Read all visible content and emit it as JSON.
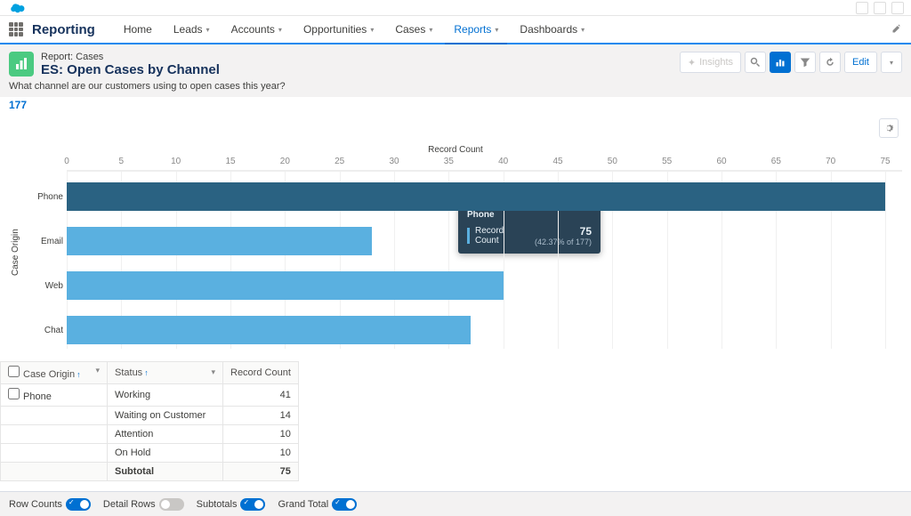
{
  "app": {
    "name": "Reporting"
  },
  "nav": {
    "items": [
      {
        "label": "Home",
        "chev": false
      },
      {
        "label": "Leads",
        "chev": true
      },
      {
        "label": "Accounts",
        "chev": true
      },
      {
        "label": "Opportunities",
        "chev": true
      },
      {
        "label": "Cases",
        "chev": true
      },
      {
        "label": "Reports",
        "chev": true,
        "active": true
      },
      {
        "label": "Dashboards",
        "chev": true
      }
    ]
  },
  "header": {
    "crumb": "Report: Cases",
    "title": "ES: Open Cases by Channel",
    "subtitle": "What channel are our customers using to open cases this year?",
    "total_label": "177",
    "actions": {
      "insights": "Insights",
      "edit": "Edit"
    }
  },
  "chart_data": {
    "type": "bar",
    "orientation": "horizontal",
    "title": "Record Count",
    "ylabel": "Case Origin",
    "xlim": [
      0,
      75
    ],
    "xticks": [
      0,
      5,
      10,
      15,
      20,
      25,
      30,
      35,
      40,
      45,
      50,
      55,
      60,
      65,
      70,
      75
    ],
    "categories": [
      "Phone",
      "Email",
      "Web",
      "Chat"
    ],
    "values": [
      75,
      28,
      40,
      37
    ],
    "highlight_index": 0,
    "total": 177
  },
  "tooltip": {
    "field_label": "Case Origin",
    "field_value": "Phone",
    "metric_label": "Record Count",
    "metric_value": "75",
    "sub": "(42.37% of 177)"
  },
  "table": {
    "columns": [
      "Case Origin",
      "Status",
      "Record Count"
    ],
    "group": "Phone",
    "rows": [
      {
        "status": "Working",
        "count": "41"
      },
      {
        "status": "Waiting on Customer",
        "count": "14"
      },
      {
        "status": "Attention",
        "count": "10"
      },
      {
        "status": "On Hold",
        "count": "10"
      }
    ],
    "subtotal_label": "Subtotal",
    "subtotal_value": "75"
  },
  "footer": {
    "row_counts": "Row Counts",
    "detail_rows": "Detail Rows",
    "subtotals": "Subtotals",
    "grand_total": "Grand Total"
  }
}
